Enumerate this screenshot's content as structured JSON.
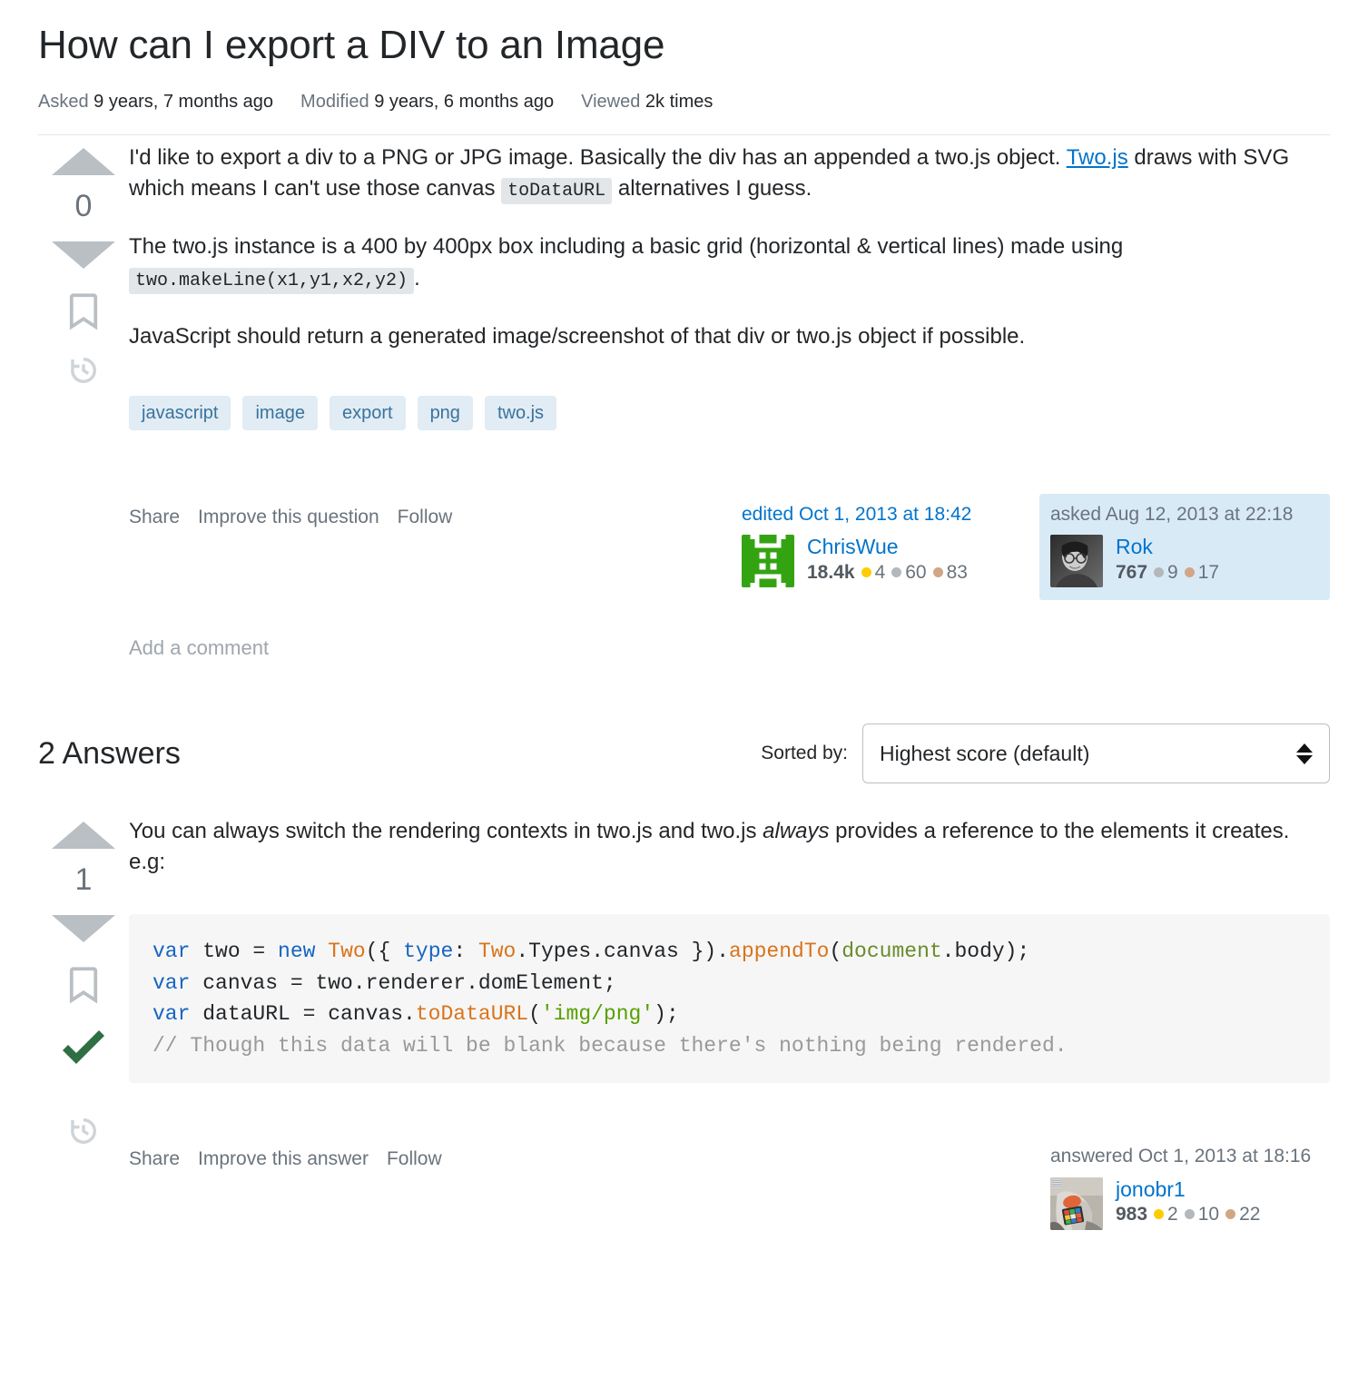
{
  "question": {
    "title": "How can I export a DIV to an Image",
    "meta": {
      "asked_label": "Asked",
      "asked_value": "9 years, 7 months ago",
      "modified_label": "Modified",
      "modified_value": "9 years, 6 months ago",
      "viewed_label": "Viewed",
      "viewed_value": "2k times"
    },
    "votes": "0",
    "body": {
      "p1_a": "I'd like to export a div to a PNG or JPG image. Basically the div has an appended a two.js object. ",
      "p1_link": "Two.js",
      "p1_b": " draws with SVG which means I can't use those canvas ",
      "p1_code": "toDataURL",
      "p1_c": " alternatives I guess.",
      "p2_a": "The two.js instance is a 400 by 400px box including a basic grid (horizontal & vertical lines) made using ",
      "p2_code": "two.makeLine(x1,y1,x2,y2)",
      "p2_b": ".",
      "p3": "JavaScript should return a generated image/screenshot of that div or two.js object if possible."
    },
    "tags": [
      "javascript",
      "image",
      "export",
      "png",
      "two.js"
    ],
    "actions": [
      "Share",
      "Improve this question",
      "Follow"
    ],
    "editor": {
      "action": "edited Oct 1, 2013 at 18:42",
      "name": "ChrisWue",
      "reputation": "18.4k",
      "gold": "4",
      "silver": "60",
      "bronze": "83",
      "avatar_kind": "identicon-green"
    },
    "asker": {
      "action": "asked Aug 12, 2013 at 22:18",
      "name": "Rok",
      "reputation": "767",
      "silver": "9",
      "bronze": "17",
      "avatar_kind": "photo-grayscale"
    },
    "add_comment": "Add a comment"
  },
  "answers_section": {
    "count_label": "2 Answers",
    "sorted_by_label": "Sorted by:",
    "sort_value": "Highest score (default)"
  },
  "answer": {
    "votes": "1",
    "accepted": true,
    "body": {
      "p1_a": "You can always switch the rendering contexts in two.js and two.js ",
      "p1_em": "always",
      "p1_b": " provides a reference to the elements it creates. e.g:"
    },
    "code": {
      "line1": {
        "k1": "var",
        "t1": " two = ",
        "k2": "new",
        "t2": " ",
        "cls": "Two",
        "t3": "({ ",
        "k3": "type",
        "t4": ": ",
        "cls2": "Two",
        "t5": ".Types.canvas }).",
        "fn": "appendTo",
        "t6": "(",
        "doc": "document",
        "t7": ".body);"
      },
      "line2": {
        "k1": "var",
        "t1": " canvas = two.renderer.domElement;"
      },
      "line3": {
        "k1": "var",
        "t1": " dataURL = canvas.",
        "fn": "toDataURL",
        "t2": "(",
        "str": "'img/png'",
        "t3": ");"
      },
      "line4": {
        "cm": "// Though this data will be blank because there's nothing being rendered."
      }
    },
    "actions": [
      "Share",
      "Improve this answer",
      "Follow"
    ],
    "author": {
      "action": "answered Oct 1, 2013 at 18:16",
      "name": "jonobr1",
      "reputation": "983",
      "gold": "2",
      "silver": "10",
      "bronze": "22",
      "avatar_kind": "photo-person"
    }
  },
  "icons": {
    "upvote": "arrow-up-icon",
    "downvote": "arrow-down-icon",
    "bookmark": "bookmark-icon",
    "history": "history-icon",
    "accepted": "check-icon"
  },
  "colors": {
    "link": "#0074cc",
    "tag_bg": "#e1ecf4",
    "tag_fg": "#39739d",
    "highlight_bg": "#d9eaf7",
    "arrow": "#babfc4",
    "accepted_green": "#2f6f44",
    "gold": "#ffcc01",
    "silver": "#b4b8bc",
    "bronze": "#d1a684"
  }
}
